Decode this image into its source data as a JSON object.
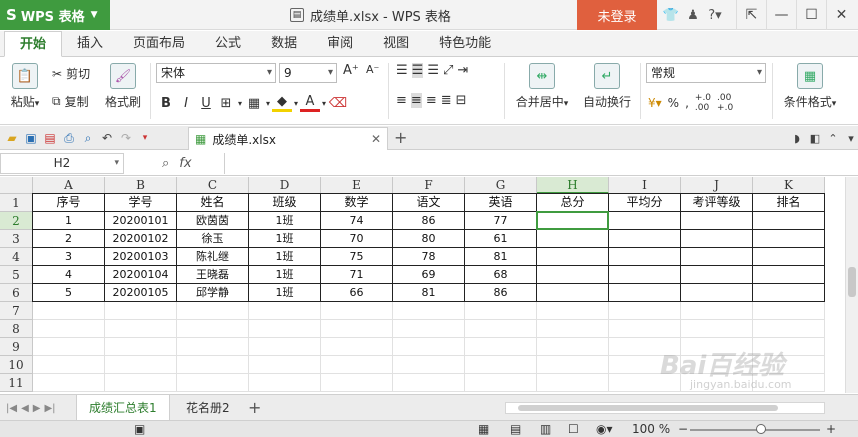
{
  "app": {
    "menu_label": "WPS 表格",
    "doc_title": "成绩单.xlsx - WPS 表格",
    "login_label": "未登录",
    "title_icons": [
      "shirt-icon",
      "skin-icon",
      "help-icon",
      "minimize-to-tray-icon"
    ]
  },
  "ribbon_tabs": [
    "开始",
    "插入",
    "页面布局",
    "公式",
    "数据",
    "审阅",
    "视图",
    "特色功能"
  ],
  "ribbon": {
    "paste_label": "粘贴",
    "cut_label": "剪切",
    "copy_label": "复制",
    "format_painter_label": "格式刷",
    "font_name": "宋体",
    "font_size": "9",
    "merge_center_label": "合并居中",
    "wrap_text_label": "自动换行",
    "number_format": "常规",
    "conditional_format_label": "条件格式"
  },
  "document_tab": {
    "filename": "成绩单.xlsx"
  },
  "formula_bar": {
    "name_box": "H2",
    "fx_label": "fx",
    "content": ""
  },
  "columns": [
    "A",
    "B",
    "C",
    "D",
    "E",
    "F",
    "G",
    "H",
    "I",
    "J",
    "K"
  ],
  "rows": [
    "1",
    "2",
    "3",
    "4",
    "5",
    "6",
    "7",
    "8",
    "9",
    "10",
    "11"
  ],
  "table": {
    "headers": [
      "序号",
      "学号",
      "姓名",
      "班级",
      "数学",
      "语文",
      "英语",
      "总分",
      "平均分",
      "考评等级",
      "排名"
    ],
    "data": [
      [
        "1",
        "20200101",
        "欧茵茵",
        "1班",
        "74",
        "86",
        "77",
        "",
        "",
        "",
        ""
      ],
      [
        "2",
        "20200102",
        "徐玉",
        "1班",
        "70",
        "80",
        "61",
        "",
        "",
        "",
        ""
      ],
      [
        "3",
        "20200103",
        "陈礼继",
        "1班",
        "75",
        "78",
        "81",
        "",
        "",
        "",
        ""
      ],
      [
        "4",
        "20200104",
        "王晓磊",
        "1班",
        "71",
        "69",
        "68",
        "",
        "",
        "",
        ""
      ],
      [
        "5",
        "20200105",
        "邱学静",
        "1班",
        "66",
        "81",
        "86",
        "",
        "",
        "",
        ""
      ]
    ]
  },
  "sheet_tabs": [
    "成绩汇总表1",
    "花名册2"
  ],
  "status": {
    "zoom": "100 %"
  },
  "watermark": {
    "main": "Bai百经验",
    "sub": "jingyan.baidu.com"
  }
}
